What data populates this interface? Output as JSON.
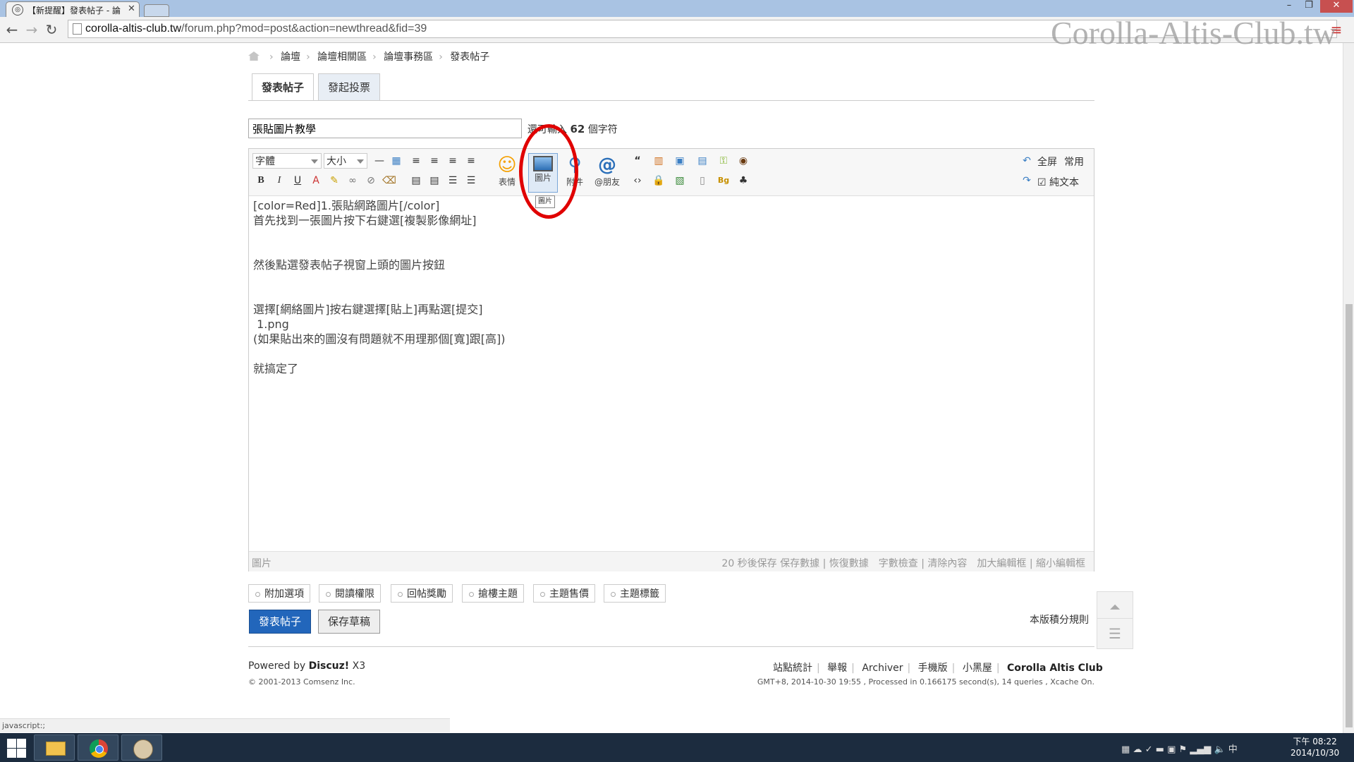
{
  "browser": {
    "tab_title": "【新提醒】發表帖子 - 論",
    "url_host": "corolla-altis-club.tw",
    "url_path": "/forum.php?mod=post&action=newthread&fid=39",
    "status_url": "javascript:;"
  },
  "watermark": "Corolla-Altis-Club.tw",
  "breadcrumb": [
    "論壇",
    "論壇相關區",
    "論壇事務區",
    "發表帖子"
  ],
  "tabs": {
    "post": "發表帖子",
    "poll": "發起投票"
  },
  "subject": {
    "value": "張貼圖片教學",
    "count_prefix": "還可輸入",
    "count": "62",
    "count_suffix": "個字符"
  },
  "toolbar": {
    "font": "字體",
    "size": "大小",
    "smiley": "表情",
    "image": "圖片",
    "attach": "附件",
    "at_friend": "@朋友",
    "fullscreen": "全屏",
    "common": "常用",
    "plain_text": "純文本",
    "tooltip": "圖片"
  },
  "editor": {
    "content": "[color=Red]1.張貼網路圖片[/color]\n首先找到一張圖片按下右鍵選[複製影像網址]\n\n\n然後點選發表帖子視窗上頭的圖片按鈕\n\n\n選擇[網絡圖片]按右鍵選擇[貼上]再點選[提交]\n 1.png\n(如果貼出來的圖沒有問題就不用理那個[寬]跟[高])\n\n就搞定了",
    "status_left": "圖片",
    "status_right": "20 秒後保存 保存數據 | 恢復數據　字數檢查 | 清除內容　加大編輯框 | 縮小編輯框"
  },
  "options": [
    "附加選項",
    "閱讀權限",
    "回帖獎勵",
    "搶樓主題",
    "主題售價",
    "主題標籤"
  ],
  "buttons": {
    "submit": "發表帖子",
    "draft": "保存草稿",
    "rules": "本版積分規則"
  },
  "footer": {
    "powered_prefix": "Powered by",
    "powered_brand": "Discuz!",
    "powered_version": "X3",
    "copyright": "© 2001-2013 Comsenz Inc.",
    "links": [
      "站點統計",
      "舉報",
      "Archiver",
      "手機版",
      "小黑屋"
    ],
    "site_name": "Corolla Altis Club",
    "stats": "GMT+8, 2014-10-30 19:55 , Processed in 0.166175 second(s), 14 queries , Xcache On."
  },
  "taskbar": {
    "ime": "中",
    "time": "下午 08:22",
    "date": "2014/10/30"
  },
  "colors": {
    "accent": "#2266bb",
    "highlight_circle": "#e00000",
    "taskbar": "#1c2c3f"
  }
}
